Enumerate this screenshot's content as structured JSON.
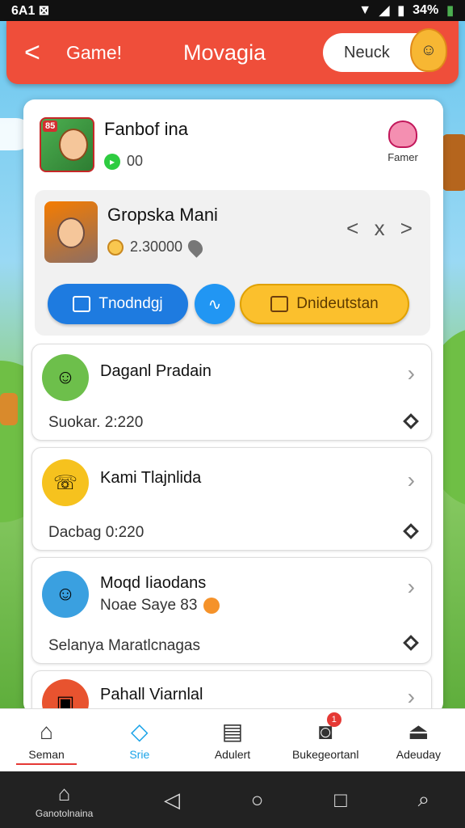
{
  "status": {
    "left": "6A1 ⊠",
    "battery": "34%"
  },
  "header": {
    "back_label": "<",
    "game_label": "Game!",
    "title": "Movagia",
    "pill_label": "Neuck"
  },
  "profile": {
    "app_badge": "85",
    "title": "Fanbof ina",
    "stat": "00",
    "fam_label": "Famer"
  },
  "featured": {
    "title": "Gropska Mani",
    "stat": "2.30000",
    "nav_label": "<  x  >",
    "btn_primary": "Tnodndgj",
    "btn_round": "∿",
    "btn_secondary": "Dnideutstan"
  },
  "items": [
    {
      "name": "Daganl Pradain",
      "sub": "",
      "foot": "Suokar. 2:220",
      "avatar_color": "#6dbf4b"
    },
    {
      "name": "Kami Tlajnlida",
      "sub": "",
      "foot": "Dacbag 0:220",
      "avatar_color": "#f6c21e"
    },
    {
      "name": "Moqd Iiaodans",
      "sub": "Noae Saye 83",
      "foot": "Selanya Maratlcnagas",
      "avatar_color": "#3aa0e0"
    },
    {
      "name": "Pahall Viarnlal",
      "sub": "",
      "foot": "",
      "avatar_color": "#e8532f"
    }
  ],
  "bottom_nav": [
    {
      "label": "Seman",
      "icon": "home-icon",
      "glyph": "⌂"
    },
    {
      "label": "Srie",
      "icon": "diamond-icon",
      "glyph": "◇"
    },
    {
      "label": "Adulert",
      "icon": "list-icon",
      "glyph": "▤"
    },
    {
      "label": "Bukegeortanl",
      "icon": "camera-icon",
      "glyph": "◙",
      "badge": "1"
    },
    {
      "label": "Adeuday",
      "icon": "tree-icon",
      "glyph": "⏏"
    }
  ],
  "system_nav": {
    "home_label": "Ganotolnaina"
  },
  "colors": {
    "header": "#ef4e3a",
    "accent_blue": "#1e7be0",
    "accent_yellow": "#fbc02d"
  }
}
